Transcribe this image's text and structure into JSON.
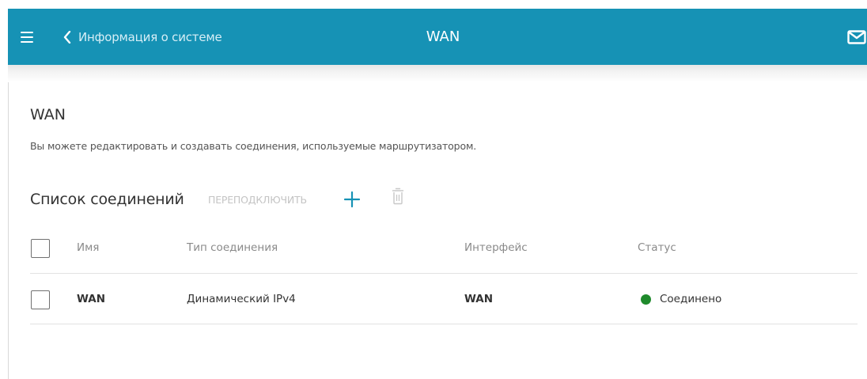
{
  "header": {
    "back_label": "Информация о системе",
    "title": "WAN",
    "icons": [
      "menu-icon",
      "chevron-left-icon",
      "mail-icon"
    ],
    "color": "#1692b5"
  },
  "page": {
    "title": "WAN",
    "description": "Вы можете редактировать и создавать соединения, используемые маршрутизатором."
  },
  "connections": {
    "title": "Список соединений",
    "reconnect_label": "ПЕРЕПОДКЛЮЧИТЬ",
    "action_icons": [
      "plus-icon",
      "trash-icon"
    ],
    "columns": {
      "name": "Имя",
      "type": "Тип соединения",
      "interface": "Интерфейс",
      "status": "Статус"
    },
    "rows": [
      {
        "name": "WAN",
        "type": "Динамический IPv4",
        "interface": "WAN",
        "status": "Соединено",
        "status_color": "#1f8a2c"
      }
    ]
  }
}
